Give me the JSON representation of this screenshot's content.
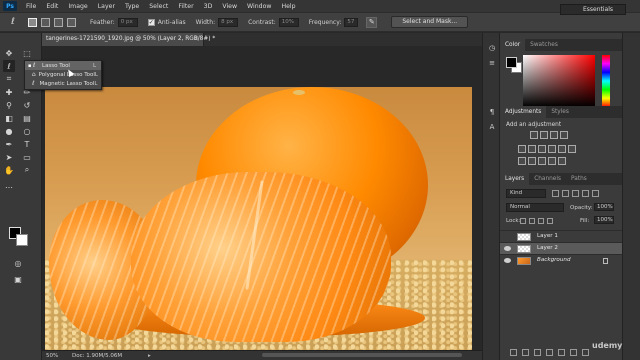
{
  "menubar": {
    "logo": "Ps",
    "items": [
      "File",
      "Edit",
      "Image",
      "Layer",
      "Type",
      "Select",
      "Filter",
      "3D",
      "View",
      "Window",
      "Help"
    ]
  },
  "options_bar": {
    "feather_label": "Feather:",
    "feather_value": "0 px",
    "antialias_label": "Anti-alias",
    "width_label": "Width:",
    "width_value": "8 px",
    "contrast_label": "Contrast:",
    "contrast_value": "10%",
    "frequency_label": "Frequency:",
    "frequency_value": "57",
    "select_mask_label": "Select and Mask...",
    "workspace_label": "Essentials"
  },
  "tool_flyout": {
    "items": [
      {
        "label": "Lasso Tool",
        "key": "L",
        "active": true
      },
      {
        "label": "Polygonal Lasso Tool",
        "key": "L",
        "active": false
      },
      {
        "label": "Magnetic Lasso Tool",
        "key": "L",
        "active": false
      }
    ]
  },
  "document": {
    "tab_title": "tangerines-1721590_1920.jpg @ 50% (Layer 2, RGB/8#) *",
    "tab_close": "×"
  },
  "status": {
    "zoom": "50%",
    "doc_info": "Doc: 1.90M/5.06M"
  },
  "color_panel": {
    "tabs": [
      "Color",
      "Swatches"
    ]
  },
  "adjustments_panel": {
    "tabs": [
      "Adjustments",
      "Styles"
    ],
    "title": "Add an adjustment"
  },
  "layers_panel": {
    "tabs": [
      "Layers",
      "Channels",
      "Paths"
    ],
    "filter_kind": "Kind",
    "blend_mode": "Normal",
    "opacity_label": "Opacity:",
    "opacity_value": "100%",
    "lock_label": "Lock:",
    "fill_label": "Fill:",
    "fill_value": "100%",
    "layers": [
      {
        "name": "Layer 1",
        "visible": false,
        "selected": false
      },
      {
        "name": "Layer 2",
        "visible": true,
        "selected": true
      },
      {
        "name": "Background",
        "visible": true,
        "selected": false
      }
    ]
  },
  "watermark": "udemy",
  "colors": {
    "app_bg": "#282828",
    "panel_bg": "#3b3b3b",
    "accent_orange": "#ff8a00"
  }
}
